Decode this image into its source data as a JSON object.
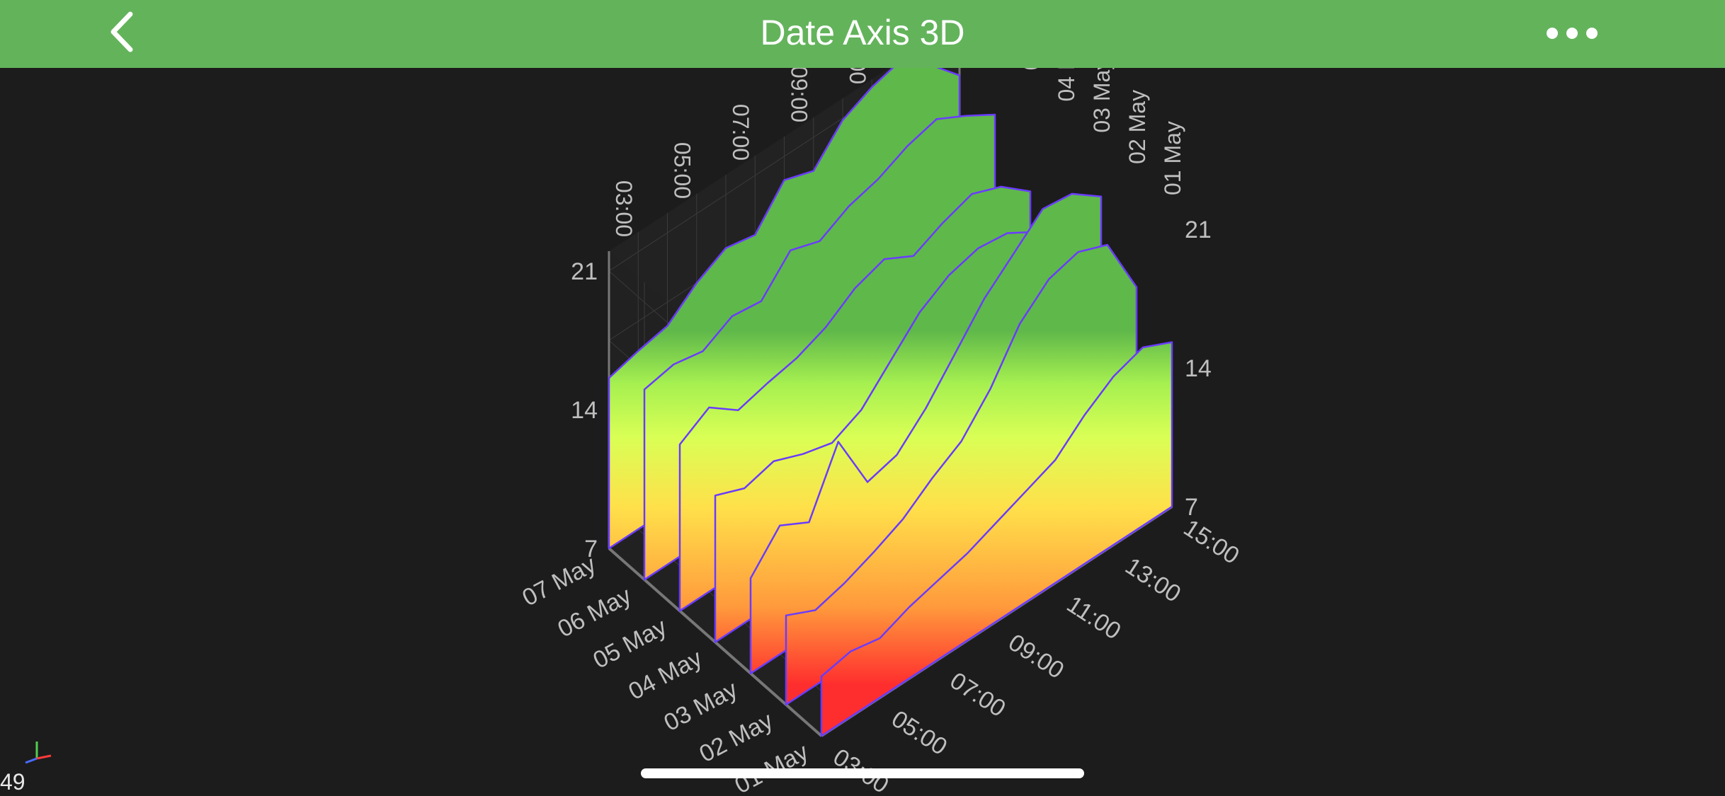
{
  "header": {
    "title": "Date Axis 3D",
    "back_icon": "chevron-left-icon",
    "more_icon": "more-horizontal-icon",
    "bar_color": "#63b35b"
  },
  "chart_data": {
    "type": "area",
    "title": "",
    "x_axis": {
      "label": "",
      "ticks": [
        "03:00",
        "05:00",
        "07:00",
        "09:00",
        "11:00",
        "13:00",
        "15:00"
      ]
    },
    "y_axis": {
      "label": "",
      "ticks": [
        7,
        14,
        21
      ],
      "range": [
        7,
        22
      ]
    },
    "z_axis": {
      "label": "",
      "ticks": [
        "01 May",
        "02 May",
        "03 May",
        "04 May",
        "05 May",
        "06 May",
        "07 May"
      ]
    },
    "colormap": [
      "#ff2e2e",
      "#ff9a3c",
      "#ffe04a",
      "#d9ff55",
      "#a6f050",
      "#5fb84a"
    ],
    "outline_color": "#6a3cff",
    "x": [
      3,
      4,
      5,
      6,
      7,
      8,
      9,
      10,
      11,
      12,
      13,
      14,
      15
    ],
    "series": [
      {
        "values": [
          10,
          10.3,
          10,
          10.6,
          11,
          11.4,
          12,
          12.6,
          13.2,
          14.5,
          15.5,
          16,
          15.3
        ]
      },
      {
        "values": [
          11.5,
          10.8,
          11.2,
          11.8,
          12.5,
          13.6,
          14.5,
          16.2,
          18.5,
          19.8,
          20.2,
          19.6,
          16.5
        ]
      },
      {
        "values": [
          11.8,
          13.5,
          12.7,
          15.8,
          12.8,
          13.2,
          14.6,
          16.4,
          18.2,
          19.5,
          20.8,
          20.6,
          19.5
        ]
      },
      {
        "values": [
          14.4,
          13.8,
          14.2,
          13.6,
          13.2,
          13.9,
          15.4,
          16.9,
          17.8,
          18.2,
          18.0,
          17.1,
          16.0
        ]
      },
      {
        "values": [
          15.4,
          16.3,
          15.2,
          15.6,
          15.9,
          16.5,
          17.5,
          18.0,
          17.2,
          17.9,
          18.4,
          17.8,
          16.6
        ]
      },
      {
        "values": [
          16.6,
          16.9,
          16.6,
          17.4,
          17.2,
          18.8,
          18.3,
          19.1,
          19.5,
          20.2,
          20.6,
          19.8,
          18.9
        ]
      },
      {
        "values": [
          15.6,
          16.0,
          16.3,
          17.5,
          18.3,
          18.0,
          19.8,
          19.3,
          20.9,
          21.6,
          22.0,
          20.8,
          19.3
        ]
      }
    ]
  },
  "stats": {
    "fps": "49"
  }
}
